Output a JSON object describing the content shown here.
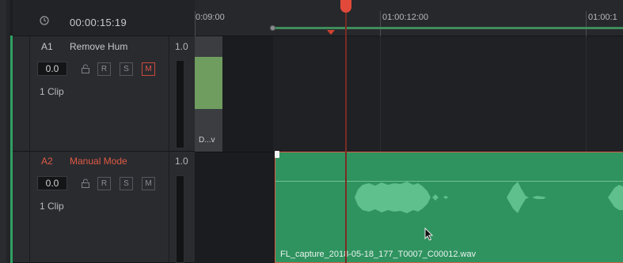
{
  "header": {
    "timecode": "00:00:15:19",
    "clock_icon": "clock-icon"
  },
  "ruler": {
    "labels": [
      "0:09:00",
      "01:00:12:00",
      "01:00:1"
    ]
  },
  "tracks": [
    {
      "id": "A1",
      "name": "Remove Hum",
      "level": "1.0",
      "volume": "0.0",
      "buttons": [
        "R",
        "S",
        "M"
      ],
      "mute_active": true,
      "clip_count": "1 Clip"
    },
    {
      "id": "A2",
      "name": "Manual Mode",
      "level": "1.0",
      "volume": "0.0",
      "buttons": [
        "R",
        "S",
        "M"
      ],
      "mute_active": false,
      "clip_count": "1 Clip"
    }
  ],
  "clips": {
    "a1_clip_label": "D...v",
    "a2_clip_label": "FL_capture_2018-05-18_177_T0007_C00012.wav"
  },
  "colors": {
    "accent_red": "#e05a44",
    "clip_green": "#2f9360",
    "track_green": "#2f9e62"
  }
}
